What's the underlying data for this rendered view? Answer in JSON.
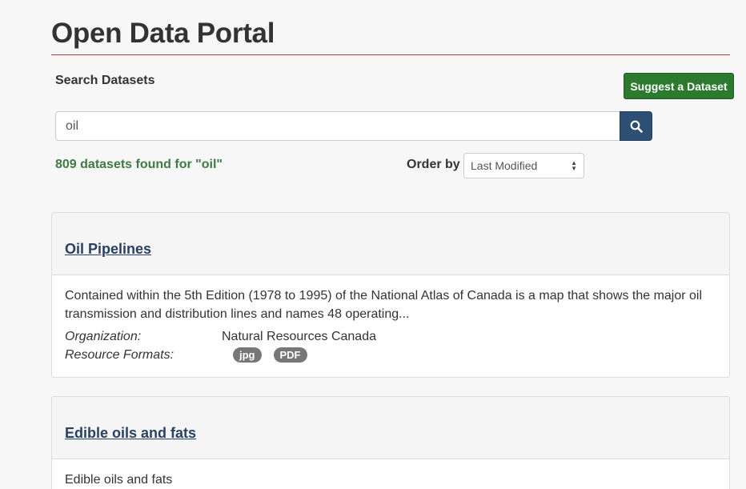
{
  "header": {
    "title": "Open Data Portal"
  },
  "search": {
    "label": "Search Datasets",
    "value": "oil",
    "suggest_label": "Suggest a Dataset",
    "search_icon": "search-icon"
  },
  "results": {
    "count_text": "809 datasets found for \"oil\"",
    "order_label": "Order by",
    "order_selected": "Last Modified"
  },
  "datasets": [
    {
      "title": "Oil Pipelines",
      "description": "Contained within the 5th Edition (1978 to 1995) of the National Atlas of Canada is a map that shows the major oil transmission and distribution lines and names 48 operating...",
      "organization_label": "Organization:",
      "organization": "Natural Resources Canada",
      "formats_label": "Resource Formats:",
      "formats": [
        "jpg",
        "PDF"
      ]
    },
    {
      "title": "Edible oils and fats",
      "description": "Edible oils and fats"
    }
  ],
  "colors": {
    "title_rule": "#af3c43",
    "suggest_button": "#2b7a2e",
    "search_button": "#2c4f73",
    "result_count": "#3e7a44",
    "link": "#284162",
    "badge": "#777777"
  }
}
